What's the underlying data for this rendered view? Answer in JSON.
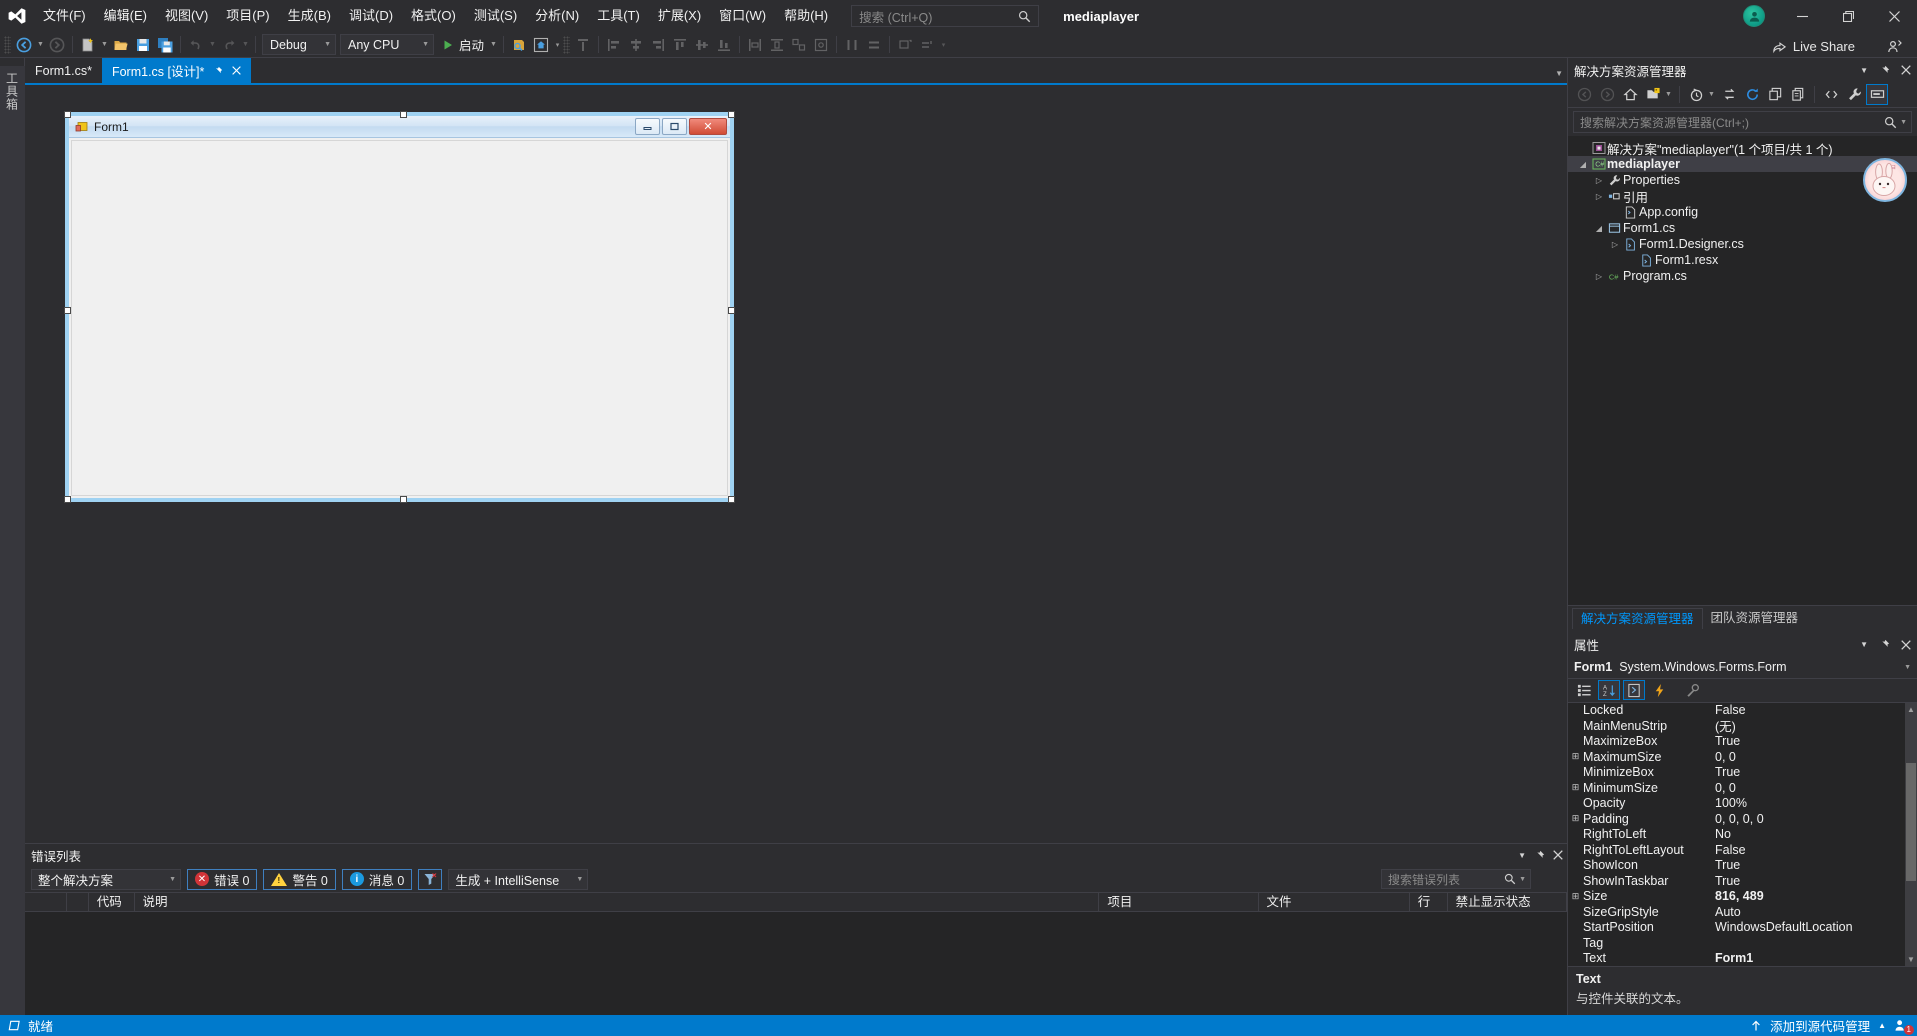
{
  "colors": {
    "accent": "#007acc",
    "chrome_bg": "#2d2d30",
    "panel_bg": "#252526",
    "error_red": "#d13438",
    "warning_yellow": "#ffd23f",
    "info_blue": "#1b9ae0",
    "link_blue": "#0097fb"
  },
  "titlebar": {
    "logo_icon": "visual-studio-logo-icon",
    "menus": [
      "文件(F)",
      "编辑(E)",
      "视图(V)",
      "项目(P)",
      "生成(B)",
      "调试(D)",
      "格式(O)",
      "测试(S)",
      "分析(N)",
      "工具(T)",
      "扩展(X)",
      "窗口(W)",
      "帮助(H)"
    ],
    "search_placeholder": "搜索 (Ctrl+Q)",
    "search_value": "",
    "search_icon": "search-icon",
    "solution_name": "mediaplayer",
    "account_icon": "user-avatar-icon",
    "minimize_icon": "minimize-icon",
    "restore_icon": "restore-icon",
    "close_icon": "close-icon"
  },
  "toolbar": {
    "items": [
      {
        "name": "navigate-backward",
        "icon": "back-arrow-icon",
        "disabled": false,
        "dropdown": true
      },
      {
        "name": "navigate-forward",
        "icon": "forward-arrow-icon",
        "disabled": true,
        "dropdown": false
      },
      {
        "name": "new-project",
        "icon": "new-file-icon",
        "disabled": false,
        "dropdown": true
      },
      {
        "name": "open-file",
        "icon": "open-folder-icon",
        "disabled": false,
        "dropdown": false
      },
      {
        "name": "save",
        "icon": "save-icon",
        "disabled": false,
        "dropdown": false
      },
      {
        "name": "save-all",
        "icon": "save-all-icon",
        "disabled": false,
        "dropdown": false
      },
      {
        "name": "undo",
        "icon": "undo-icon",
        "disabled": true,
        "dropdown": true
      },
      {
        "name": "redo",
        "icon": "redo-icon",
        "disabled": true,
        "dropdown": true
      }
    ],
    "config_combo": "Debug",
    "platform_combo": "Any CPU",
    "start_button": "启动",
    "start_icon": "play-icon",
    "after_start": [
      {
        "name": "hot-reload",
        "icon": "hot-reload-icon",
        "disabled": false
      },
      {
        "name": "live-visual-tree",
        "icon": "home-frame-icon",
        "disabled": false
      }
    ],
    "align_tools": [
      {
        "name": "bring-to-front",
        "icon": "bring-to-front-icon",
        "disabled": true
      },
      {
        "name": "align-lefts",
        "icon": "align-left-icon",
        "disabled": true
      },
      {
        "name": "align-centers",
        "icon": "align-center-icon",
        "disabled": true
      },
      {
        "name": "align-rights",
        "icon": "align-right-icon",
        "disabled": true
      },
      {
        "name": "align-tops",
        "icon": "align-top-icon",
        "disabled": true
      },
      {
        "name": "align-middles",
        "icon": "align-middle-icon",
        "disabled": true
      },
      {
        "name": "align-bottoms",
        "icon": "align-bottom-icon",
        "disabled": true
      },
      {
        "name": "make-same-width",
        "icon": "same-width-icon",
        "disabled": true
      },
      {
        "name": "make-same-height",
        "icon": "same-height-icon",
        "disabled": true
      },
      {
        "name": "make-same-size",
        "icon": "same-size-icon",
        "disabled": true
      },
      {
        "name": "size-to-grid",
        "icon": "size-to-grid-icon",
        "disabled": true
      },
      {
        "name": "horizontal-spacing",
        "icon": "horizontal-spacing-icon",
        "disabled": true
      },
      {
        "name": "vertical-spacing",
        "icon": "vertical-spacing-icon",
        "disabled": true
      },
      {
        "name": "center-horizontally",
        "icon": "center-horizontally-icon",
        "disabled": true
      },
      {
        "name": "center-vertically",
        "icon": "center-vertically-icon",
        "disabled": true
      }
    ],
    "live_share_label": "Live Share",
    "live_share_icon": "live-share-icon",
    "feedback_icon": "send-feedback-icon"
  },
  "toolbox": {
    "label": "工具箱"
  },
  "document_tabs": [
    {
      "label": "Form1.cs*",
      "active": false,
      "pinned": false,
      "closable": false
    },
    {
      "label": "Form1.cs [设计]*",
      "active": true,
      "pinned": true,
      "closable": true
    }
  ],
  "designer": {
    "form_title": "Form1",
    "form_icon": "windows-form-icon",
    "minimize_icon": "form-minimize-icon",
    "maximize_icon": "form-maximize-icon",
    "close_icon": "form-close-icon",
    "selected": true
  },
  "error_list": {
    "title": "错误列表",
    "scope_filter": "整个解决方案",
    "errors_label": "错误 0",
    "warnings_label": "警告 0",
    "messages_label": "消息 0",
    "filter_icon": "funnel-filter-icon",
    "source_filter": "生成 + IntelliSense",
    "search_placeholder": "搜索错误列表",
    "columns": [
      "",
      "",
      "代码",
      "说明",
      "项目",
      "文件",
      "行",
      "禁止显示状态"
    ],
    "rows": [],
    "dropdown_icon": "chevron-down-icon",
    "pin_icon": "pin-icon",
    "close_icon": "close-icon"
  },
  "solution_explorer": {
    "title": "解决方案资源管理器",
    "dropdown_icon": "chevron-down-icon",
    "pin_icon": "pin-icon",
    "close_icon": "close-icon",
    "toolbar": [
      {
        "name": "back",
        "icon": "back-circle-icon",
        "disabled": true
      },
      {
        "name": "forward",
        "icon": "forward-circle-icon",
        "disabled": true
      },
      {
        "name": "home",
        "icon": "home-icon",
        "disabled": false
      },
      {
        "name": "pending-changes-filter",
        "icon": "filter-folder-icon",
        "disabled": false,
        "dropdown": true
      },
      {
        "name": "show-all-files-history",
        "icon": "clock-icon",
        "disabled": false,
        "dropdown": true
      },
      {
        "name": "sync-with-active-document",
        "icon": "sync-arrows-icon",
        "disabled": false
      },
      {
        "name": "refresh",
        "icon": "refresh-icon",
        "disabled": false
      },
      {
        "name": "collapse-all",
        "icon": "collapse-all-icon",
        "disabled": false
      },
      {
        "name": "show-all-files",
        "icon": "show-all-files-icon",
        "disabled": false
      },
      {
        "name": "view-code",
        "icon": "code-brackets-icon",
        "disabled": false
      },
      {
        "name": "properties",
        "icon": "wrench-icon",
        "disabled": false
      },
      {
        "name": "preview-selected-items",
        "icon": "preview-icon",
        "disabled": false,
        "selected": true
      }
    ],
    "search_placeholder": "搜索解决方案资源管理器(Ctrl+;)",
    "tree": [
      {
        "indent": 0,
        "twisty": "",
        "icon": "solution-icon",
        "label": "解决方案\"mediaplayer\"(1 个项目/共 1 个)",
        "bold": false,
        "selected": false
      },
      {
        "indent": 1,
        "twisty": "expanded",
        "icon": "csharp-project-icon",
        "label": "mediaplayer",
        "bold": true,
        "selected": true
      },
      {
        "indent": 2,
        "twisty": "collapsed",
        "icon": "wrench-icon",
        "label": "Properties",
        "bold": false,
        "selected": false
      },
      {
        "indent": 2,
        "twisty": "collapsed",
        "icon": "references-icon",
        "label": "引用",
        "bold": false,
        "selected": false
      },
      {
        "indent": 3,
        "twisty": "",
        "icon": "config-file-icon",
        "label": "App.config",
        "bold": false,
        "selected": false
      },
      {
        "indent": 2,
        "twisty": "expanded",
        "icon": "form-file-icon",
        "label": "Form1.cs",
        "bold": false,
        "selected": false
      },
      {
        "indent": 3,
        "twisty": "collapsed",
        "icon": "csharp-file-icon",
        "label": "Form1.Designer.cs",
        "bold": false,
        "selected": false
      },
      {
        "indent": 4,
        "twisty": "",
        "icon": "resx-file-icon",
        "label": "Form1.resx",
        "bold": false,
        "selected": false
      },
      {
        "indent": 2,
        "twisty": "collapsed",
        "icon": "csharp-file-icon",
        "label": "Program.cs",
        "bold": false,
        "selected": false
      }
    ],
    "mascot_icon": "rabbit-avatar-icon",
    "tabs": [
      {
        "label": "解决方案资源管理器",
        "active": true
      },
      {
        "label": "团队资源管理器",
        "active": false
      }
    ]
  },
  "properties": {
    "title": "属性",
    "dropdown_icon": "chevron-down-icon",
    "pin_icon": "pin-icon",
    "close_icon": "close-icon",
    "object_name": "Form1",
    "object_type": "System.Windows.Forms.Form",
    "toolbar": [
      {
        "name": "categorized",
        "icon": "categorized-icon",
        "selected": false
      },
      {
        "name": "alphabetical",
        "icon": "sort-alpha-icon",
        "selected": true
      },
      {
        "name": "properties-page",
        "icon": "properties-page-icon",
        "selected": true
      },
      {
        "name": "events",
        "icon": "lightning-events-icon",
        "selected": false
      },
      {
        "name": "property-pages",
        "icon": "property-pages-icon",
        "selected": false
      }
    ],
    "rows": [
      {
        "expandable": false,
        "name": "Locked",
        "value": "False",
        "bold": false
      },
      {
        "expandable": false,
        "name": "MainMenuStrip",
        "value": "(无)",
        "bold": false
      },
      {
        "expandable": false,
        "name": "MaximizeBox",
        "value": "True",
        "bold": false
      },
      {
        "expandable": true,
        "name": "MaximumSize",
        "value": "0, 0",
        "bold": false
      },
      {
        "expandable": false,
        "name": "MinimizeBox",
        "value": "True",
        "bold": false
      },
      {
        "expandable": true,
        "name": "MinimumSize",
        "value": "0, 0",
        "bold": false
      },
      {
        "expandable": false,
        "name": "Opacity",
        "value": "100%",
        "bold": false
      },
      {
        "expandable": true,
        "name": "Padding",
        "value": "0, 0, 0, 0",
        "bold": false
      },
      {
        "expandable": false,
        "name": "RightToLeft",
        "value": "No",
        "bold": false
      },
      {
        "expandable": false,
        "name": "RightToLeftLayout",
        "value": "False",
        "bold": false
      },
      {
        "expandable": false,
        "name": "ShowIcon",
        "value": "True",
        "bold": false
      },
      {
        "expandable": false,
        "name": "ShowInTaskbar",
        "value": "True",
        "bold": false
      },
      {
        "expandable": true,
        "name": "Size",
        "value": "816, 489",
        "bold": true
      },
      {
        "expandable": false,
        "name": "SizeGripStyle",
        "value": "Auto",
        "bold": false
      },
      {
        "expandable": false,
        "name": "StartPosition",
        "value": "WindowsDefaultLocation",
        "bold": false
      },
      {
        "expandable": false,
        "name": "Tag",
        "value": "",
        "bold": false
      },
      {
        "expandable": false,
        "name": "Text",
        "value": "Form1",
        "bold": true
      }
    ],
    "description_title": "Text",
    "description_text": "与控件关联的文本。"
  },
  "statusbar": {
    "ready_icon": "ready-flag-icon",
    "ready_text": "就绪",
    "source_control_icon": "up-arrow-icon",
    "source_control_text": "添加到源代码管理",
    "source_control_caret": "caret-up-icon",
    "notification_icon": "notifications-icon",
    "notification_count": "1"
  }
}
